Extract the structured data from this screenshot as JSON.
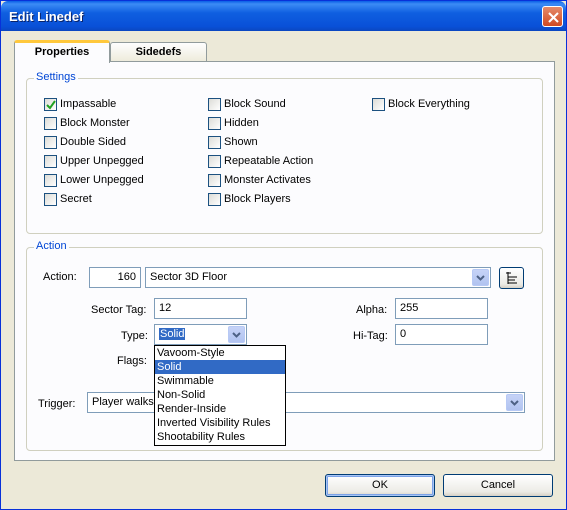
{
  "window": {
    "title": "Edit Linedef"
  },
  "tabs": [
    {
      "label": "Properties"
    },
    {
      "label": "Sidedefs"
    }
  ],
  "settings": {
    "title": "Settings",
    "checkboxes": [
      {
        "label": "Impassable",
        "checked": true
      },
      {
        "label": "Block Monster",
        "checked": false
      },
      {
        "label": "Double Sided",
        "checked": false
      },
      {
        "label": "Upper Unpegged",
        "checked": false
      },
      {
        "label": "Lower Unpegged",
        "checked": false
      },
      {
        "label": "Secret",
        "checked": false
      },
      {
        "label": "Block Sound",
        "checked": false
      },
      {
        "label": "Hidden",
        "checked": false
      },
      {
        "label": "Shown",
        "checked": false
      },
      {
        "label": "Repeatable Action",
        "checked": false
      },
      {
        "label": "Monster Activates",
        "checked": false
      },
      {
        "label": "Block Players",
        "checked": false
      },
      {
        "label": "Block Everything",
        "checked": false
      }
    ]
  },
  "action": {
    "title": "Action",
    "action_label": "Action:",
    "action_number": "160",
    "action_name": "Sector 3D Floor",
    "sector_tag_label": "Sector Tag:",
    "sector_tag": "12",
    "type_label": "Type:",
    "type_value": "Solid",
    "flags_label": "Flags:",
    "alpha_label": "Alpha:",
    "alpha": "255",
    "hitag_label": "Hi-Tag:",
    "hitag": "0",
    "trigger_label": "Trigger:",
    "trigger_value": "Player walks"
  },
  "type_options": [
    "Vavoom-Style",
    "Solid",
    "Swimmable",
    "Non-Solid",
    "Render-Inside",
    "Inverted Visibility Rules",
    "Shootability Rules"
  ],
  "type_selected_index": 1,
  "buttons": {
    "ok": "OK",
    "cancel": "Cancel"
  },
  "colors": {
    "titlebar": "#0a5fe6",
    "group_label": "#0046d5",
    "selection": "#316ac5",
    "tab_highlight": "#ffc83c"
  }
}
